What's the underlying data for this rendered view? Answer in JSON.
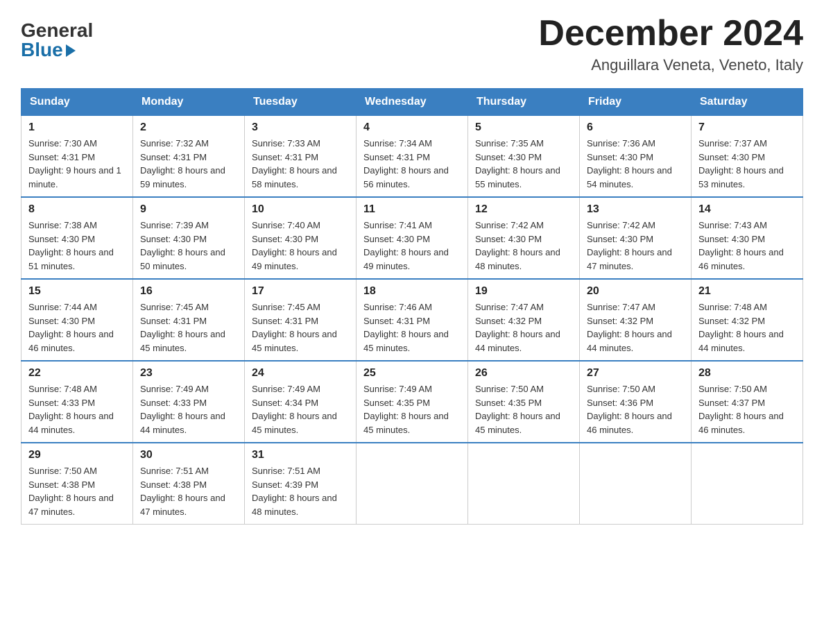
{
  "header": {
    "logo": {
      "general": "General",
      "blue": "Blue"
    },
    "title": "December 2024",
    "location": "Anguillara Veneta, Veneto, Italy"
  },
  "calendar": {
    "days_of_week": [
      "Sunday",
      "Monday",
      "Tuesday",
      "Wednesday",
      "Thursday",
      "Friday",
      "Saturday"
    ],
    "weeks": [
      [
        {
          "day": "1",
          "sunrise": "7:30 AM",
          "sunset": "4:31 PM",
          "daylight": "9 hours and 1 minute."
        },
        {
          "day": "2",
          "sunrise": "7:32 AM",
          "sunset": "4:31 PM",
          "daylight": "8 hours and 59 minutes."
        },
        {
          "day": "3",
          "sunrise": "7:33 AM",
          "sunset": "4:31 PM",
          "daylight": "8 hours and 58 minutes."
        },
        {
          "day": "4",
          "sunrise": "7:34 AM",
          "sunset": "4:31 PM",
          "daylight": "8 hours and 56 minutes."
        },
        {
          "day": "5",
          "sunrise": "7:35 AM",
          "sunset": "4:30 PM",
          "daylight": "8 hours and 55 minutes."
        },
        {
          "day": "6",
          "sunrise": "7:36 AM",
          "sunset": "4:30 PM",
          "daylight": "8 hours and 54 minutes."
        },
        {
          "day": "7",
          "sunrise": "7:37 AM",
          "sunset": "4:30 PM",
          "daylight": "8 hours and 53 minutes."
        }
      ],
      [
        {
          "day": "8",
          "sunrise": "7:38 AM",
          "sunset": "4:30 PM",
          "daylight": "8 hours and 51 minutes."
        },
        {
          "day": "9",
          "sunrise": "7:39 AM",
          "sunset": "4:30 PM",
          "daylight": "8 hours and 50 minutes."
        },
        {
          "day": "10",
          "sunrise": "7:40 AM",
          "sunset": "4:30 PM",
          "daylight": "8 hours and 49 minutes."
        },
        {
          "day": "11",
          "sunrise": "7:41 AM",
          "sunset": "4:30 PM",
          "daylight": "8 hours and 49 minutes."
        },
        {
          "day": "12",
          "sunrise": "7:42 AM",
          "sunset": "4:30 PM",
          "daylight": "8 hours and 48 minutes."
        },
        {
          "day": "13",
          "sunrise": "7:42 AM",
          "sunset": "4:30 PM",
          "daylight": "8 hours and 47 minutes."
        },
        {
          "day": "14",
          "sunrise": "7:43 AM",
          "sunset": "4:30 PM",
          "daylight": "8 hours and 46 minutes."
        }
      ],
      [
        {
          "day": "15",
          "sunrise": "7:44 AM",
          "sunset": "4:30 PM",
          "daylight": "8 hours and 46 minutes."
        },
        {
          "day": "16",
          "sunrise": "7:45 AM",
          "sunset": "4:31 PM",
          "daylight": "8 hours and 45 minutes."
        },
        {
          "day": "17",
          "sunrise": "7:45 AM",
          "sunset": "4:31 PM",
          "daylight": "8 hours and 45 minutes."
        },
        {
          "day": "18",
          "sunrise": "7:46 AM",
          "sunset": "4:31 PM",
          "daylight": "8 hours and 45 minutes."
        },
        {
          "day": "19",
          "sunrise": "7:47 AM",
          "sunset": "4:32 PM",
          "daylight": "8 hours and 44 minutes."
        },
        {
          "day": "20",
          "sunrise": "7:47 AM",
          "sunset": "4:32 PM",
          "daylight": "8 hours and 44 minutes."
        },
        {
          "day": "21",
          "sunrise": "7:48 AM",
          "sunset": "4:32 PM",
          "daylight": "8 hours and 44 minutes."
        }
      ],
      [
        {
          "day": "22",
          "sunrise": "7:48 AM",
          "sunset": "4:33 PM",
          "daylight": "8 hours and 44 minutes."
        },
        {
          "day": "23",
          "sunrise": "7:49 AM",
          "sunset": "4:33 PM",
          "daylight": "8 hours and 44 minutes."
        },
        {
          "day": "24",
          "sunrise": "7:49 AM",
          "sunset": "4:34 PM",
          "daylight": "8 hours and 45 minutes."
        },
        {
          "day": "25",
          "sunrise": "7:49 AM",
          "sunset": "4:35 PM",
          "daylight": "8 hours and 45 minutes."
        },
        {
          "day": "26",
          "sunrise": "7:50 AM",
          "sunset": "4:35 PM",
          "daylight": "8 hours and 45 minutes."
        },
        {
          "day": "27",
          "sunrise": "7:50 AM",
          "sunset": "4:36 PM",
          "daylight": "8 hours and 46 minutes."
        },
        {
          "day": "28",
          "sunrise": "7:50 AM",
          "sunset": "4:37 PM",
          "daylight": "8 hours and 46 minutes."
        }
      ],
      [
        {
          "day": "29",
          "sunrise": "7:50 AM",
          "sunset": "4:38 PM",
          "daylight": "8 hours and 47 minutes."
        },
        {
          "day": "30",
          "sunrise": "7:51 AM",
          "sunset": "4:38 PM",
          "daylight": "8 hours and 47 minutes."
        },
        {
          "day": "31",
          "sunrise": "7:51 AM",
          "sunset": "4:39 PM",
          "daylight": "8 hours and 48 minutes."
        },
        null,
        null,
        null,
        null
      ]
    ]
  }
}
